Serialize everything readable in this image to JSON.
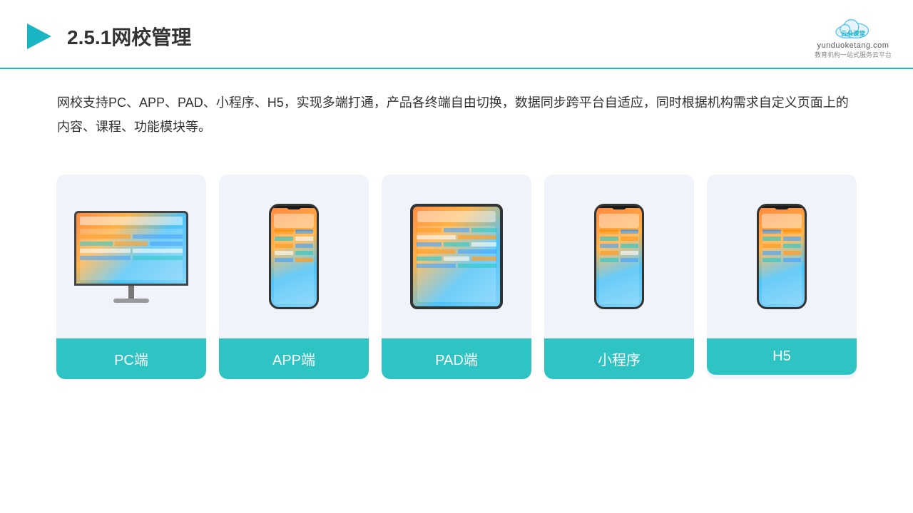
{
  "header": {
    "title": "2.5.1网校管理",
    "logo_name": "云朵课堂",
    "logo_domain": "yunduoketang.com",
    "logo_tagline": "教育机构一站式服务云平台"
  },
  "description": {
    "text": "网校支持PC、APP、PAD、小程序、H5，实现多端打通，产品各终端自由切换，数据同步跨平台自适应，同时根据机构需求自定义页面上的内容、课程、功能模块等。"
  },
  "cards": [
    {
      "id": "pc",
      "label": "PC端"
    },
    {
      "id": "app",
      "label": "APP端"
    },
    {
      "id": "pad",
      "label": "PAD端"
    },
    {
      "id": "miniprogram",
      "label": "小程序"
    },
    {
      "id": "h5",
      "label": "H5"
    }
  ],
  "accent_color": "#2ec4c4"
}
